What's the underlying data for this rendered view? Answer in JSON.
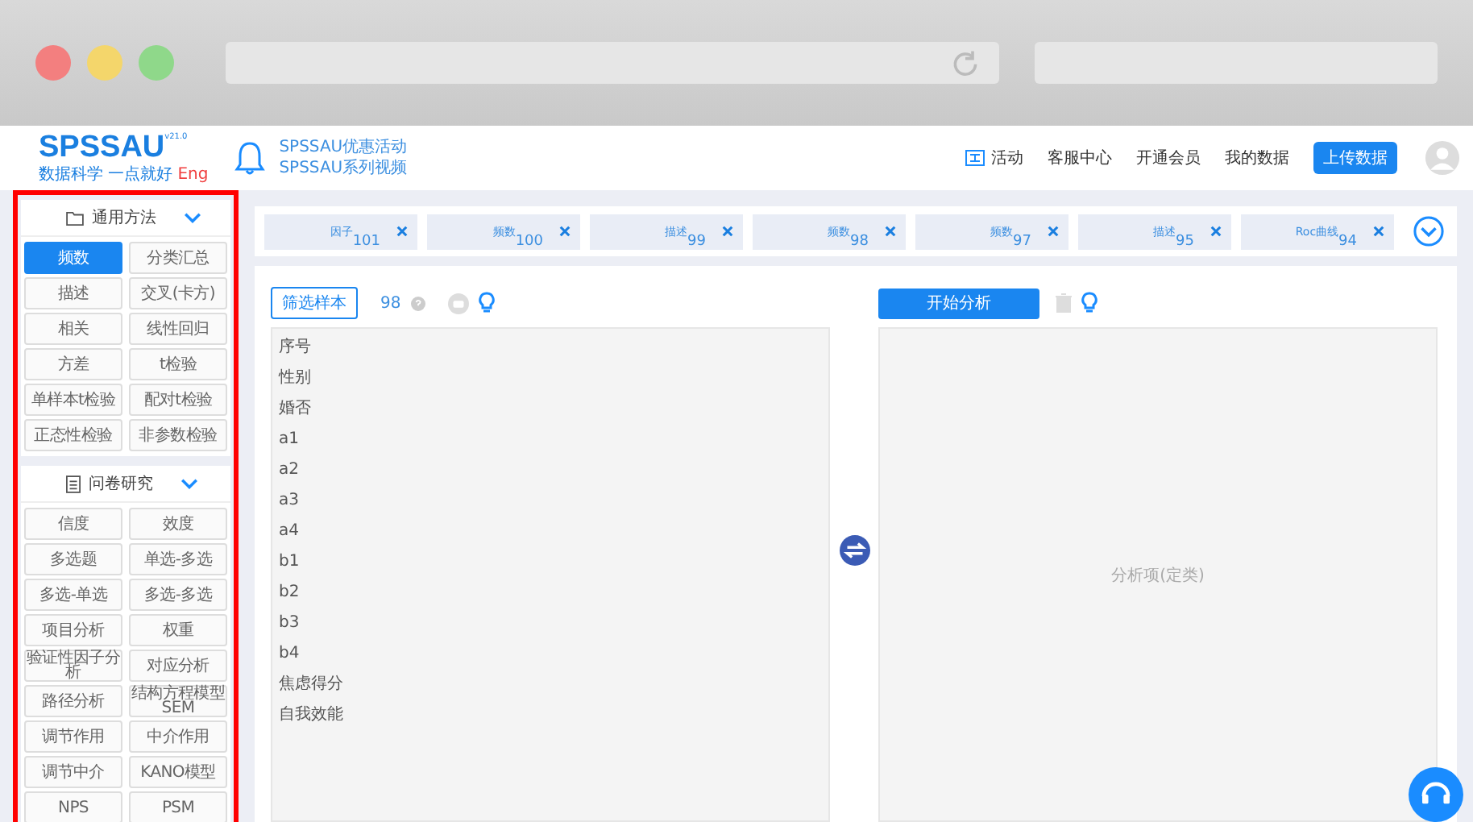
{
  "header": {
    "logo": "SPSSAU",
    "version": "v21.0",
    "slogan": "数据科学 一点就好",
    "language": "Eng",
    "promo_links": [
      "SPSSAU优惠活动",
      "SPSSAU系列视频"
    ],
    "nav": [
      {
        "label": "活动",
        "kind": "icon"
      },
      {
        "label": "客服中心",
        "kind": "text"
      },
      {
        "label": "开通会员",
        "kind": "text"
      },
      {
        "label": "我的数据",
        "kind": "text"
      }
    ],
    "upload_button": "上传数据"
  },
  "sidebar": {
    "sections": [
      {
        "title": "通用方法",
        "kind": "folder",
        "expanded": true,
        "items": [
          {
            "label": "频数",
            "selected": true
          },
          {
            "label": "分类汇总",
            "selected": false
          },
          {
            "label": "描述",
            "selected": false
          },
          {
            "label": "交叉(卡方)",
            "selected": false
          },
          {
            "label": "相关",
            "selected": false
          },
          {
            "label": "线性回归",
            "selected": false
          },
          {
            "label": "方差",
            "selected": false
          },
          {
            "label": "t检验",
            "selected": false
          },
          {
            "label": "单样本t检验",
            "selected": false
          },
          {
            "label": "配对t检验",
            "selected": false
          },
          {
            "label": "正态性检验",
            "selected": false
          },
          {
            "label": "非参数检验",
            "selected": false
          }
        ]
      },
      {
        "title": "问卷研究",
        "kind": "document",
        "expanded": true,
        "items": [
          {
            "label": "信度",
            "selected": false
          },
          {
            "label": "效度",
            "selected": false
          },
          {
            "label": "多选题",
            "selected": false
          },
          {
            "label": "单选-多选",
            "selected": false
          },
          {
            "label": "多选-单选",
            "selected": false
          },
          {
            "label": "多选-多选",
            "selected": false
          },
          {
            "label": "项目分析",
            "selected": false
          },
          {
            "label": "权重",
            "selected": false
          },
          {
            "label": "验证性因子分析",
            "selected": false
          },
          {
            "label": "对应分析",
            "selected": false
          },
          {
            "label": "路径分析",
            "selected": false
          },
          {
            "label": "结构方程模型SEM",
            "selected": false
          },
          {
            "label": "调节作用",
            "selected": false
          },
          {
            "label": "中介作用",
            "selected": false
          },
          {
            "label": "调节中介",
            "selected": false
          },
          {
            "label": "KANO模型",
            "selected": false
          },
          {
            "label": "NPS",
            "selected": false
          },
          {
            "label": "PSM",
            "selected": false
          }
        ]
      }
    ]
  },
  "history_tabs": [
    {
      "label": "因子",
      "count": "101"
    },
    {
      "label": "频数",
      "count": "100"
    },
    {
      "label": "描述",
      "count": "99"
    },
    {
      "label": "频数",
      "count": "98"
    },
    {
      "label": "频数",
      "count": "97"
    },
    {
      "label": "描述",
      "count": "95"
    },
    {
      "label": "Roc曲线",
      "count": "94"
    }
  ],
  "toolbar": {
    "filter_button": "筛选样本",
    "sample_count": "98",
    "analyze_button": "开始分析"
  },
  "variables": [
    "序号",
    "性别",
    "婚否",
    "a1",
    "a2",
    "a3",
    "a4",
    "b1",
    "b2",
    "b3",
    "b4",
    "焦虑得分",
    "自我效能"
  ],
  "target_box": {
    "placeholder": "分析项(定类)"
  }
}
